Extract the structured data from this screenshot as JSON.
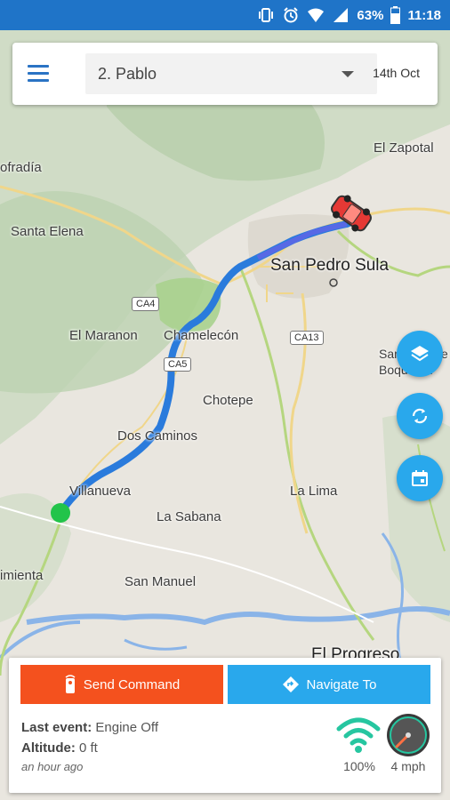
{
  "status_bar": {
    "battery": "63%",
    "time": "11:18",
    "icons": [
      "vibrate-icon",
      "alarm-icon",
      "wifi-icon",
      "signal-icon",
      "battery-icon"
    ]
  },
  "top_bar": {
    "device_selected": "2. Pablo",
    "date": "14th Oct"
  },
  "map": {
    "labels": [
      "El Zapotal",
      "ofradía",
      "Santa Elena",
      "San Pedro Sula",
      "El Maranon",
      "Chamelecón",
      "San José de Boquerón",
      "Chotepe",
      "Dos Caminos",
      "Villanueva",
      "La Lima",
      "La Sabana",
      "imienta",
      "San Manuel",
      "El Progreso"
    ],
    "road_shields": [
      "CA4",
      "CA13",
      "CA5"
    ]
  },
  "fabs": [
    "layers-icon",
    "refresh-icon",
    "calendar-icon"
  ],
  "panel": {
    "send_command_label": "Send Command",
    "navigate_label": "Navigate To",
    "last_event_label": "Last event:",
    "last_event_value": "Engine Off",
    "altitude_label": "Altitude:",
    "altitude_value": "0 ft",
    "time_ago": "an hour ago",
    "signal_value": "100%",
    "speed_value": "4 mph"
  },
  "colors": {
    "status_bar": "#1f74c8",
    "send_button": "#f4511e",
    "accent": "#29a8ec",
    "route": "#2a7bdc",
    "start_marker": "#22c44a",
    "vehicle": "#e53935"
  }
}
